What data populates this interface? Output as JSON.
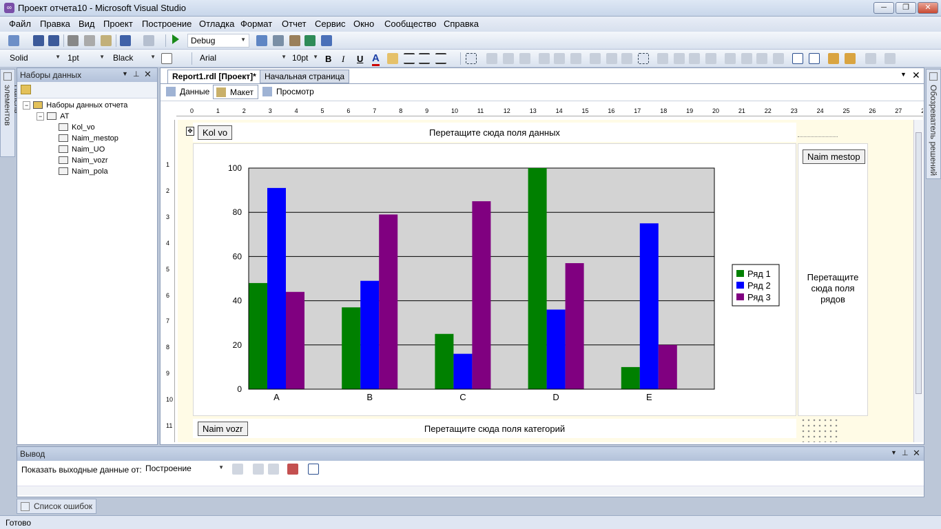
{
  "window": {
    "title": "Проект отчета10 - Microsoft Visual Studio",
    "min_glyph": "─",
    "restore_glyph": "❐",
    "close_glyph": "✕"
  },
  "menu": [
    "Файл",
    "Правка",
    "Вид",
    "Проект",
    "Построение",
    "Отладка",
    "Формат",
    "Отчет",
    "Сервис",
    "Окно",
    "Сообщество",
    "Справка"
  ],
  "toolbar1": {
    "config": "Debug"
  },
  "toolbar2": {
    "line_style": "Solid",
    "line_width": "1pt",
    "color": "Black",
    "font": "Arial",
    "font_size": "10pt",
    "bold": "B",
    "italic": "I",
    "underline": "U",
    "font_color": "A"
  },
  "left_tab": {
    "label": "Панель элементов"
  },
  "datasets_panel": {
    "title": "Наборы данных",
    "root": "Наборы данных отчета",
    "dataset": "AT",
    "fields": [
      "Kol_vo",
      "Naim_mestop",
      "Naim_UO",
      "Naim_vozr",
      "Naim_pola"
    ]
  },
  "document": {
    "tabs": [
      "Report1.rdl [Проект]*",
      "Начальная страница"
    ],
    "subtabs": [
      "Данные",
      "Макет",
      "Просмотр"
    ],
    "ruler_top": [
      "0",
      "1",
      "2",
      "3",
      "4",
      "5",
      "6",
      "7",
      "8",
      "9",
      "10",
      "11",
      "12",
      "13",
      "14",
      "15",
      "16",
      "17",
      "18",
      "19",
      "20",
      "21",
      "22",
      "23",
      "24",
      "25",
      "26",
      "27",
      "28"
    ],
    "ruler_left": [
      "1",
      "2",
      "3",
      "4",
      "5",
      "6",
      "7",
      "8",
      "9",
      "10",
      "11"
    ]
  },
  "report": {
    "data_drop_text": "Перетащите сюда поля данных",
    "data_field": "Kol vo",
    "series_field": "Naim mestop",
    "series_drop_text": [
      "Перетащите",
      "сюда поля",
      "рядов"
    ],
    "category_field": "Naim vozr",
    "category_drop_text": "Перетащите сюда поля категорий"
  },
  "chart_data": {
    "type": "bar",
    "categories": [
      "A",
      "B",
      "C",
      "D",
      "E"
    ],
    "series": [
      {
        "name": "Ряд 1",
        "color": "#008000",
        "values": [
          48,
          37,
          25,
          100,
          10
        ]
      },
      {
        "name": "Ряд 2",
        "color": "#0000ff",
        "values": [
          91,
          49,
          16,
          36,
          75
        ]
      },
      {
        "name": "Ряд 3",
        "color": "#800080",
        "values": [
          44,
          79,
          85,
          57,
          20
        ]
      }
    ],
    "ylim": [
      0,
      100
    ],
    "yticks": [
      0,
      20,
      40,
      60,
      80,
      100
    ],
    "grid": true,
    "legend": "right",
    "plot_background": "#d3d3d3"
  },
  "right_tab": {
    "label": "Обозреватель решений"
  },
  "output_panel": {
    "title": "Вывод",
    "show_label": "Показать выходные данные от:",
    "source": "Построение"
  },
  "error_tab": {
    "label": "Список ошибок"
  },
  "status": {
    "text": "Готово"
  }
}
